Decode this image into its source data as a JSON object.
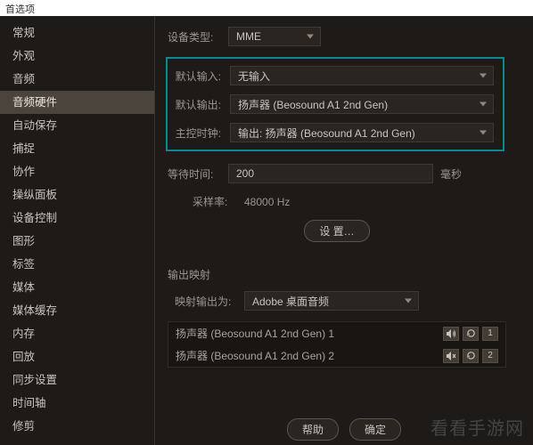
{
  "title": "首选项",
  "sidebar": {
    "items": [
      {
        "label": "常规"
      },
      {
        "label": "外观"
      },
      {
        "label": "音频"
      },
      {
        "label": "音频硬件"
      },
      {
        "label": "自动保存"
      },
      {
        "label": "捕捉"
      },
      {
        "label": "协作"
      },
      {
        "label": "操纵面板"
      },
      {
        "label": "设备控制"
      },
      {
        "label": "图形"
      },
      {
        "label": "标签"
      },
      {
        "label": "媒体"
      },
      {
        "label": "媒体缓存"
      },
      {
        "label": "内存"
      },
      {
        "label": "回放"
      },
      {
        "label": "同步设置"
      },
      {
        "label": "时间轴"
      },
      {
        "label": "修剪"
      }
    ],
    "selectedIndex": 3
  },
  "content": {
    "deviceClass": {
      "label": "设备类型:",
      "value": "MME"
    },
    "defaultInput": {
      "label": "默认输入:",
      "value": "无输入"
    },
    "defaultOutput": {
      "label": "默认输出:",
      "value": "扬声器 (Beosound A1 2nd Gen)"
    },
    "clock": {
      "label": "主控时钟:",
      "value": "输出: 扬声器 (Beosound A1 2nd Gen)"
    },
    "latency": {
      "label": "等待时间:",
      "value": "200",
      "unit": "毫秒"
    },
    "sampleRate": {
      "label": "采样率:",
      "value": "48000 Hz"
    },
    "settingsBtn": "设 置…",
    "outputMapTitle": "输出映射",
    "outputMap": {
      "label": "映射输出为:",
      "value": "Adobe 桌面音频"
    },
    "outputs": [
      {
        "name": "扬声器 (Beosound A1 2nd Gen) 1",
        "num": "1"
      },
      {
        "name": "扬声器 (Beosound A1 2nd Gen) 2",
        "num": "2"
      }
    ]
  },
  "buttons": {
    "help": "帮助",
    "ok": "确定"
  },
  "watermark": "看看手游网"
}
